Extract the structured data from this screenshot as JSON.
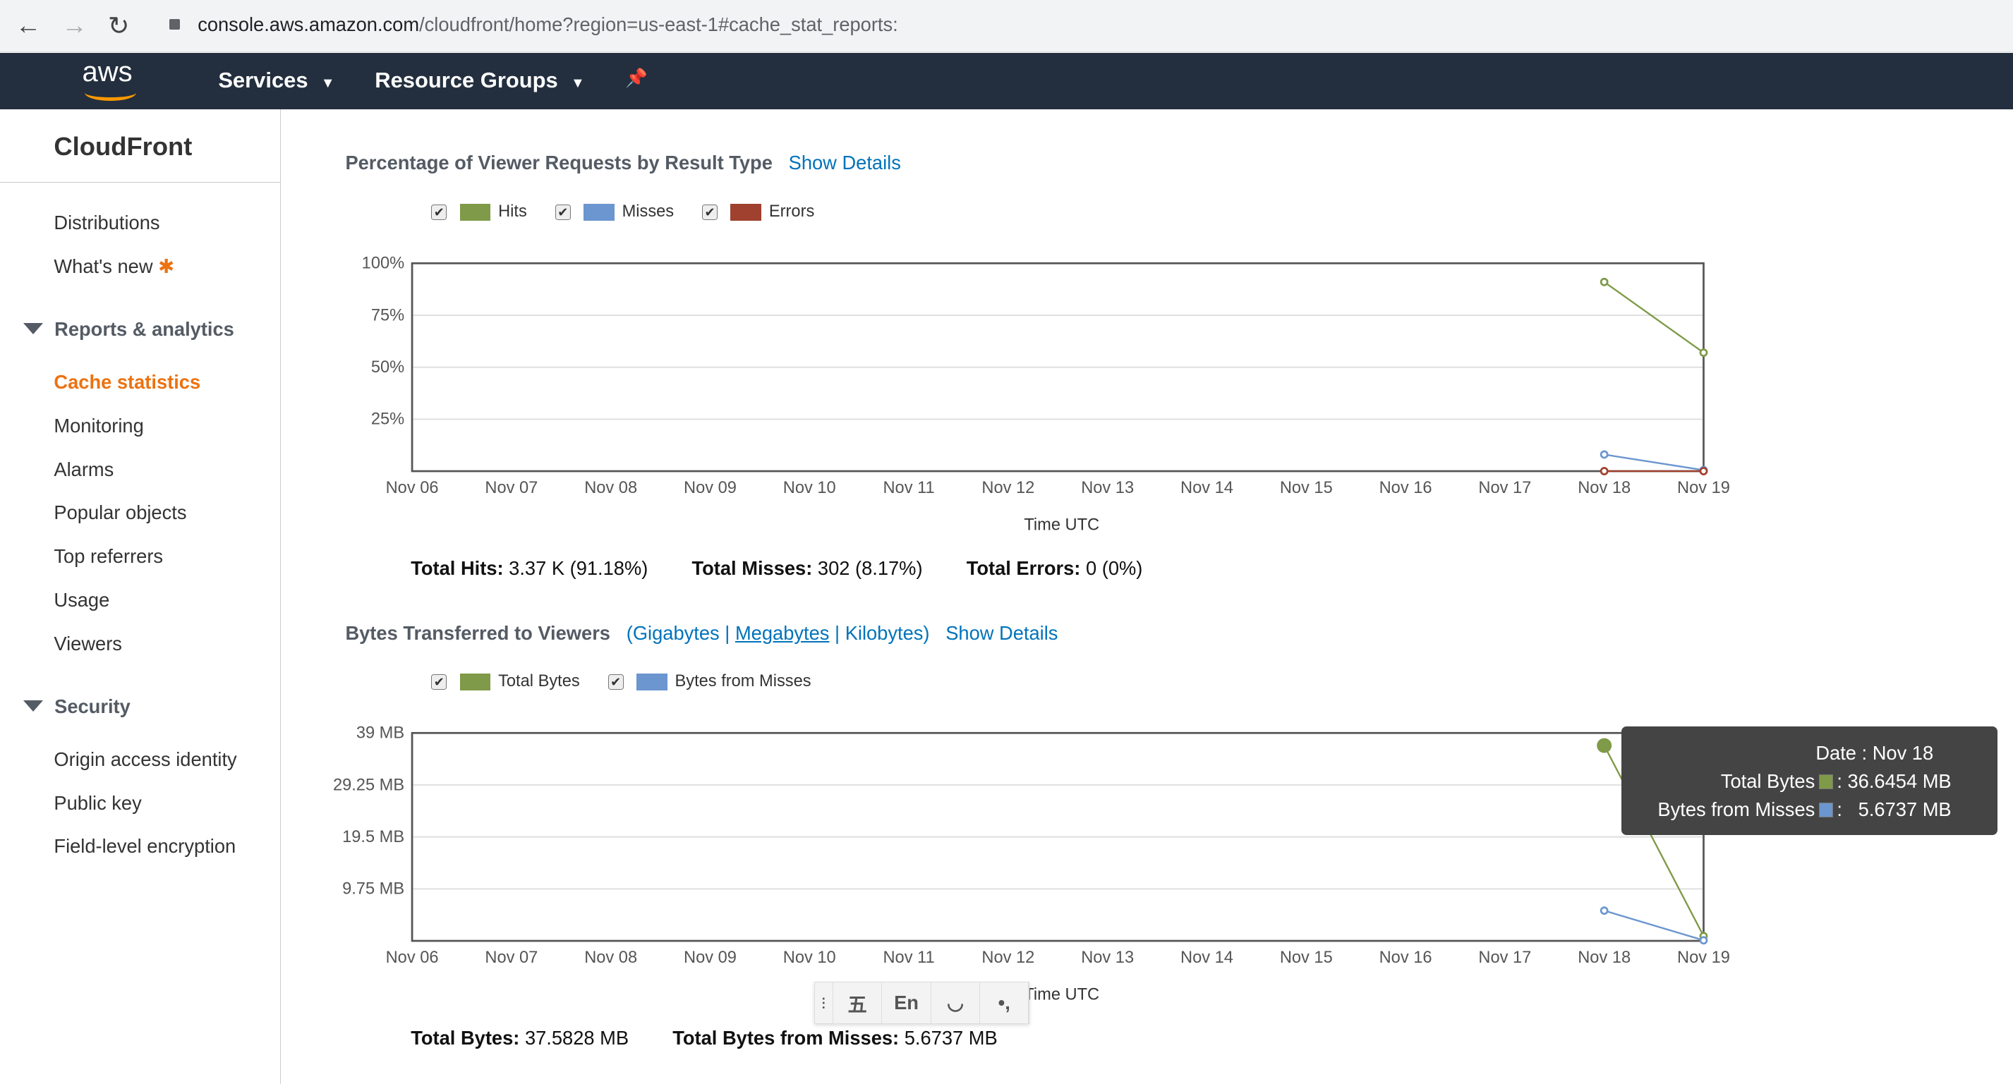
{
  "browser": {
    "url_domain": "console.aws.amazon.com",
    "url_path": "/cloudfront/home?region=us-east-1#cache_stat_reports:",
    "back": "←",
    "forward": "→",
    "reload": "↻"
  },
  "topnav": {
    "logo": "aws",
    "services": "Services",
    "resource_groups": "Resource Groups",
    "pin": "📌"
  },
  "sidebar": {
    "title": "CloudFront",
    "items": [
      "Distributions",
      "What's new"
    ],
    "new_star": "✱",
    "reports_header": "Reports & analytics",
    "reports_items": [
      "Cache statistics",
      "Monitoring",
      "Alarms",
      "Popular objects",
      "Top referrers",
      "Usage",
      "Viewers"
    ],
    "security_header": "Security",
    "security_items": [
      "Origin access identity",
      "Public key",
      "Field-level encryption"
    ]
  },
  "colors": {
    "hits": "#7f9a48",
    "misses": "#6b96cf",
    "errors": "#a0402f"
  },
  "section1": {
    "title": "Percentage of Viewer Requests by Result Type",
    "show_details": "Show Details",
    "legend": [
      "Hits",
      "Misses",
      "Errors"
    ],
    "totals": [
      {
        "label": "Total Hits:",
        "value": "3.37 K (91.18%)"
      },
      {
        "label": "Total Misses:",
        "value": "302 (8.17%)"
      },
      {
        "label": "Total Errors:",
        "value": "0 (0%)"
      }
    ]
  },
  "section2": {
    "title": "Bytes Transferred to Viewers",
    "units_open": "(",
    "units": [
      "Gigabytes",
      "Megabytes",
      "Kilobytes"
    ],
    "sep": "|",
    "units_close": ")",
    "show_details": "Show Details",
    "legend": [
      "Total Bytes",
      "Bytes from Misses"
    ],
    "totals": [
      {
        "label": "Total Bytes:",
        "value": "37.5828 MB"
      },
      {
        "label": "Total Bytes from Misses:",
        "value": "5.6737 MB"
      }
    ]
  },
  "tooltip": {
    "date": "Date : Nov 18",
    "rows": [
      {
        "label": "Total Bytes",
        "value": ": 36.6454 MB"
      },
      {
        "label": "Bytes from Misses",
        "value": ":   5.6737 MB"
      }
    ]
  },
  "ime": {
    "items": [
      "五",
      "En",
      "◡",
      "•,"
    ]
  },
  "chart_data": [
    {
      "type": "line",
      "title": "Percentage of Viewer Requests by Result Type",
      "xlabel": "Time UTC",
      "ylabel": "",
      "categories": [
        "Nov 06",
        "Nov 07",
        "Nov 08",
        "Nov 09",
        "Nov 10",
        "Nov 11",
        "Nov 12",
        "Nov 13",
        "Nov 14",
        "Nov 15",
        "Nov 16",
        "Nov 17",
        "Nov 18",
        "Nov 19"
      ],
      "yticks": [
        "25%",
        "50%",
        "75%",
        "100%"
      ],
      "ylim": [
        0,
        100
      ],
      "series": [
        {
          "name": "Hits",
          "color": "#7f9a48",
          "points": [
            [
              12,
              91
            ],
            [
              13,
              57
            ]
          ]
        },
        {
          "name": "Misses",
          "color": "#6b96cf",
          "points": [
            [
              12,
              8
            ],
            [
              13,
              0.5
            ]
          ]
        },
        {
          "name": "Errors",
          "color": "#a0402f",
          "points": [
            [
              12,
              0
            ],
            [
              13,
              0
            ]
          ]
        }
      ]
    },
    {
      "type": "line",
      "title": "Bytes Transferred to Viewers",
      "xlabel": "Time UTC",
      "ylabel": "",
      "categories": [
        "Nov 06",
        "Nov 07",
        "Nov 08",
        "Nov 09",
        "Nov 10",
        "Nov 11",
        "Nov 12",
        "Nov 13",
        "Nov 14",
        "Nov 15",
        "Nov 16",
        "Nov 17",
        "Nov 18",
        "Nov 19"
      ],
      "yticks": [
        "9.75 MB",
        "19.5 MB",
        "29.25 MB",
        "39 MB"
      ],
      "ylim": [
        0,
        39
      ],
      "series": [
        {
          "name": "Total Bytes",
          "color": "#7f9a48",
          "points": [
            [
              12,
              36.6454
            ],
            [
              13,
              0.9
            ]
          ]
        },
        {
          "name": "Bytes from Misses",
          "color": "#6b96cf",
          "points": [
            [
              12,
              5.6737
            ],
            [
              13,
              0.1
            ]
          ]
        }
      ]
    }
  ]
}
